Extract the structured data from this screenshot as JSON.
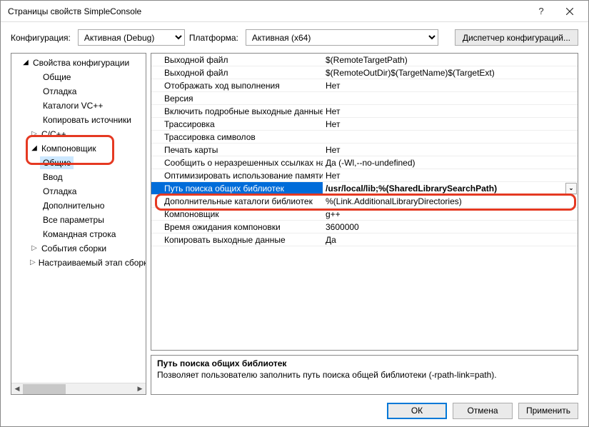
{
  "window_title": "Страницы свойств SimpleConsole",
  "config": {
    "label": "Конфигурация:",
    "value": "Активная (Debug)"
  },
  "platform": {
    "label": "Платформа:",
    "value": "Активная (x64)"
  },
  "config_manager_btn": "Диспетчер конфигураций...",
  "tree": {
    "root": "Свойства конфигурации",
    "items": [
      {
        "label": "Общие",
        "depth": 2
      },
      {
        "label": "Отладка",
        "depth": 2
      },
      {
        "label": "Каталоги VC++",
        "depth": 2
      },
      {
        "label": "Копировать источники",
        "depth": 2
      },
      {
        "label": "C/C++",
        "depth": 1,
        "expander": "closed"
      },
      {
        "label": "Компоновщик",
        "depth": 1,
        "expander": "open"
      },
      {
        "label": "Общие",
        "depth": 2,
        "selected": true
      },
      {
        "label": "Ввод",
        "depth": 2
      },
      {
        "label": "Отладка",
        "depth": 2
      },
      {
        "label": "Дополнительно",
        "depth": 2
      },
      {
        "label": "Все параметры",
        "depth": 2
      },
      {
        "label": "Командная строка",
        "depth": 2
      },
      {
        "label": "События сборки",
        "depth": 1,
        "expander": "closed"
      },
      {
        "label": "Настраиваемый этап сборки",
        "depth": 1,
        "expander": "closed"
      }
    ]
  },
  "grid": [
    {
      "name": "Выходной файл",
      "value": "$(RemoteTargetPath)"
    },
    {
      "name": "Выходной файл",
      "value": "$(RemoteOutDir)$(TargetName)$(TargetExt)"
    },
    {
      "name": "Отображать ход выполнения",
      "value": "Нет"
    },
    {
      "name": "Версия",
      "value": ""
    },
    {
      "name": "Включить подробные выходные данные",
      "value": "Нет"
    },
    {
      "name": "Трассировка",
      "value": "Нет"
    },
    {
      "name": "Трассировка символов",
      "value": ""
    },
    {
      "name": "Печать карты",
      "value": "Нет"
    },
    {
      "name": "Сообщить о неразрешенных ссылках на символы",
      "value": "Да (-Wl,--no-undefined)"
    },
    {
      "name": "Оптимизировать использование памяти",
      "value": "Нет"
    },
    {
      "name": "Путь поиска общих библиотек",
      "value": "/usr/local/lib;%(SharedLibrarySearchPath)",
      "selected": true
    },
    {
      "name": "Дополнительные каталоги библиотек",
      "value": "%(Link.AdditionalLibraryDirectories)"
    },
    {
      "name": "Компоновщик",
      "value": "g++"
    },
    {
      "name": "Время ожидания компоновки",
      "value": "3600000"
    },
    {
      "name": "Копировать выходные данные",
      "value": "Да"
    }
  ],
  "description": {
    "title": "Путь поиска общих библиотек",
    "text": "Позволяет пользователю заполнить путь поиска общей библиотеки (-rpath-link=path)."
  },
  "buttons": {
    "ok": "ОК",
    "cancel": "Отмена",
    "apply": "Применить"
  }
}
